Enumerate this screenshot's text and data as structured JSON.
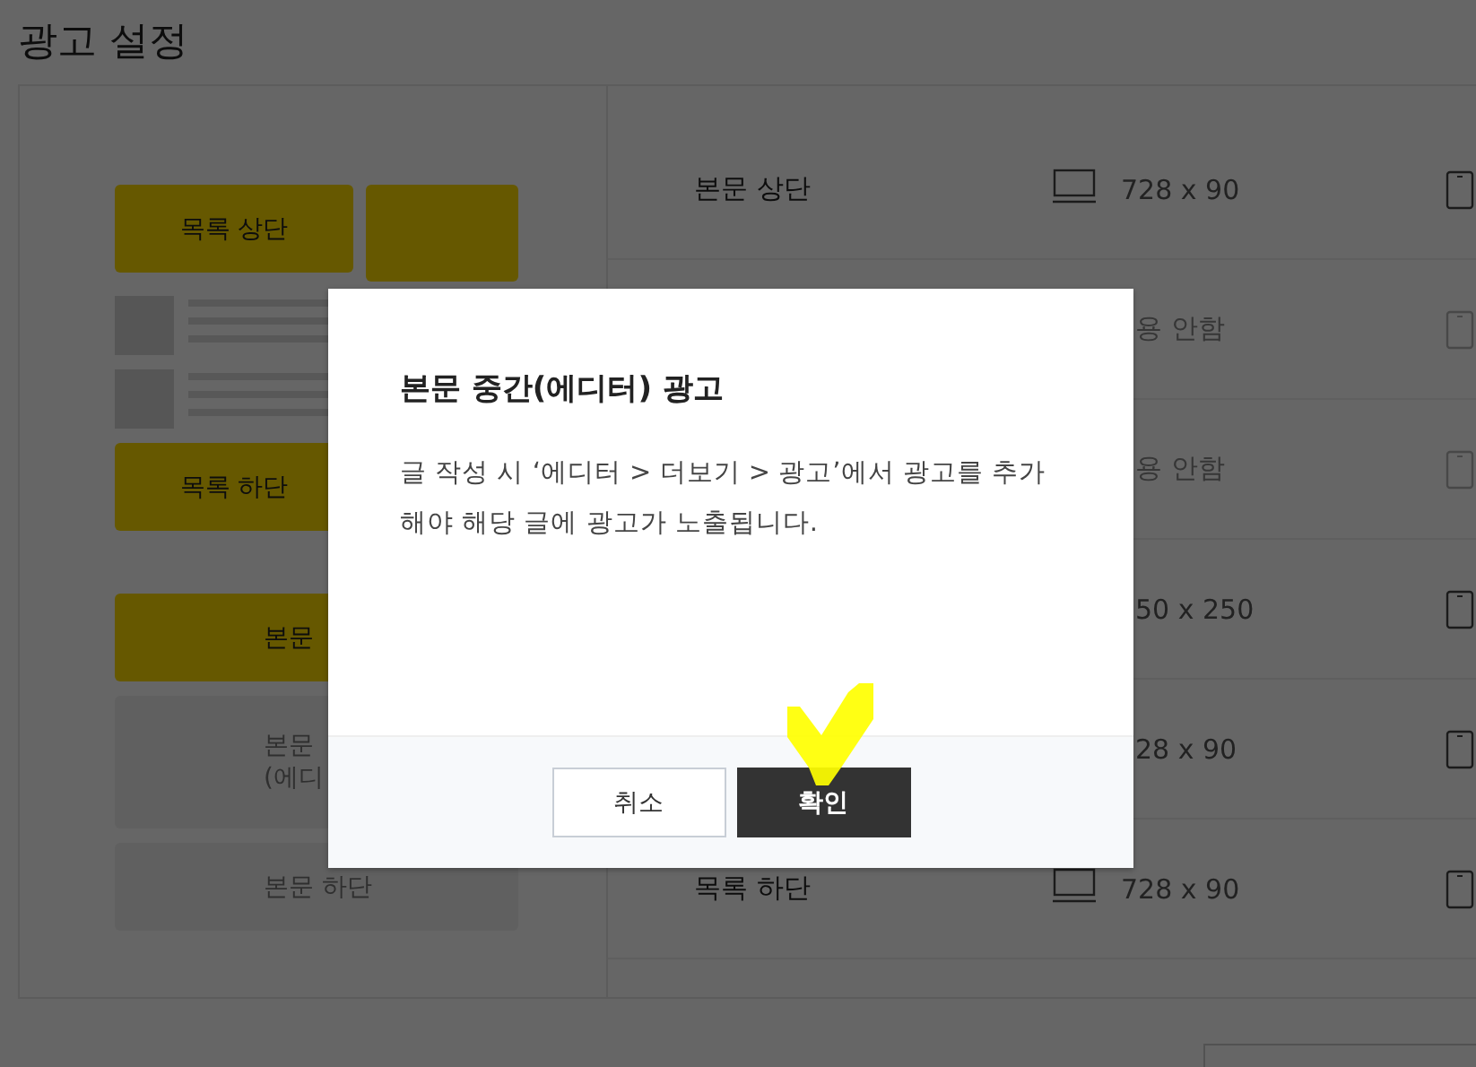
{
  "page": {
    "title": "광고 설정"
  },
  "preview": [
    {
      "kind": "ad-pair",
      "label": "목록 상단",
      "enabled": true
    },
    {
      "kind": "post-list"
    },
    {
      "kind": "ad",
      "label": "목록 하단",
      "enabled": true
    },
    {
      "kind": "ad-wide",
      "lines": [
        "본문"
      ],
      "enabled": true
    },
    {
      "kind": "ad-wide",
      "lines": [
        "본문",
        "(에디"
      ],
      "enabled": false
    },
    {
      "kind": "ad-wide",
      "lines": [
        "본문 하단"
      ],
      "enabled": false
    }
  ],
  "placements": [
    {
      "label": "본문 상단",
      "kind": "desktop",
      "size": "728 x 90",
      "enabled": true
    },
    {
      "kind": "covered",
      "size": "용 안함",
      "enabled": false
    },
    {
      "kind": "covered",
      "size": "용 안함",
      "enabled": false
    },
    {
      "kind": "covered",
      "size": "50 x 250",
      "enabled": true
    },
    {
      "kind": "covered",
      "size": "28 x 90",
      "enabled": true
    },
    {
      "label": "목록 하단",
      "kind": "desktop",
      "size": "728 x 90",
      "enabled": true
    }
  ],
  "dialog": {
    "title": "본문 중간(에디터) 광고",
    "message": "글 작성 시 ‘에디터 > 더보기 > 광고’에서 광고를 추가해야 해당 글에 광고가 노출됩니다.",
    "buttons": [
      {
        "label": "취소",
        "kind": "secondary"
      },
      {
        "label": "확인",
        "kind": "primary"
      }
    ]
  }
}
